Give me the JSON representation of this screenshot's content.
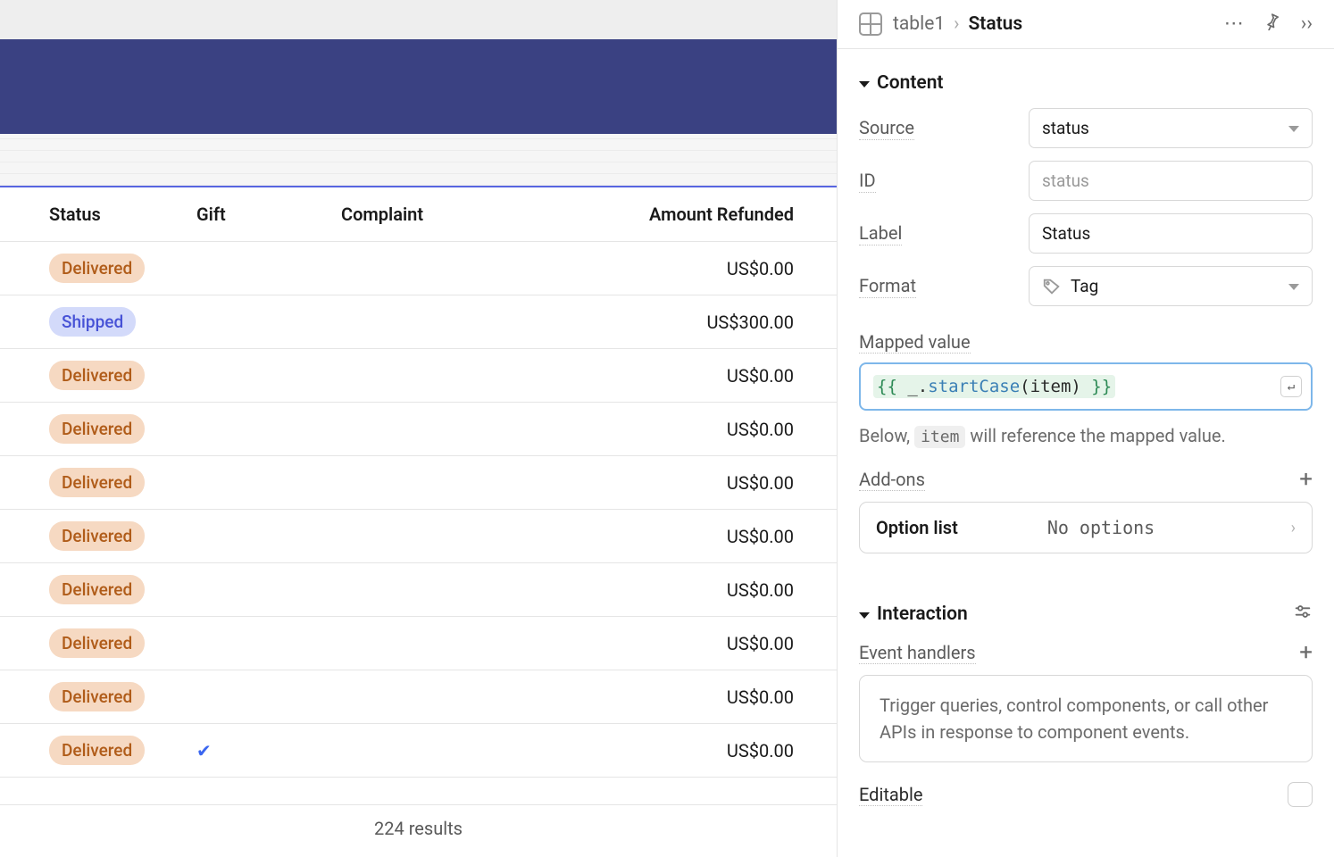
{
  "breadcrumb": {
    "parent": "table1",
    "current": "Status"
  },
  "table": {
    "columns": {
      "status": "Status",
      "gift": "Gift",
      "complaint": "Complaint",
      "amount": "Amount Refunded"
    },
    "rows": [
      {
        "status": "Delivered",
        "status_kind": "delivered",
        "gift": false,
        "amount": "US$0.00"
      },
      {
        "status": "Shipped",
        "status_kind": "shipped",
        "gift": false,
        "amount": "US$300.00"
      },
      {
        "status": "Delivered",
        "status_kind": "delivered",
        "gift": false,
        "amount": "US$0.00"
      },
      {
        "status": "Delivered",
        "status_kind": "delivered",
        "gift": false,
        "amount": "US$0.00"
      },
      {
        "status": "Delivered",
        "status_kind": "delivered",
        "gift": false,
        "amount": "US$0.00"
      },
      {
        "status": "Delivered",
        "status_kind": "delivered",
        "gift": false,
        "amount": "US$0.00"
      },
      {
        "status": "Delivered",
        "status_kind": "delivered",
        "gift": false,
        "amount": "US$0.00"
      },
      {
        "status": "Delivered",
        "status_kind": "delivered",
        "gift": false,
        "amount": "US$0.00"
      },
      {
        "status": "Delivered",
        "status_kind": "delivered",
        "gift": false,
        "amount": "US$0.00"
      },
      {
        "status": "Delivered",
        "status_kind": "delivered",
        "gift": true,
        "amount": "US$0.00"
      }
    ],
    "footer": "224 results"
  },
  "panel": {
    "content_section": "Content",
    "source_label": "Source",
    "source_value": "status",
    "id_label": "ID",
    "id_placeholder": "status",
    "label_label": "Label",
    "label_value": "Status",
    "format_label": "Format",
    "format_value": "Tag",
    "mapped_label": "Mapped value",
    "mapped_open": "{{ ",
    "mapped_prefix": "_.",
    "mapped_fn": "startCase",
    "mapped_arg_open": "(",
    "mapped_arg": "item",
    "mapped_arg_close": ")",
    "mapped_close": " }}",
    "hint_prefix": "Below, ",
    "hint_code": "item",
    "hint_suffix": " will reference the mapped value.",
    "addons_label": "Add-ons",
    "option_list_name": "Option list",
    "option_list_value": "No options",
    "interaction_section": "Interaction",
    "event_handlers_label": "Event handlers",
    "event_handlers_hint": "Trigger queries, control components, or call other APIs in response to component events.",
    "editable_label": "Editable"
  }
}
